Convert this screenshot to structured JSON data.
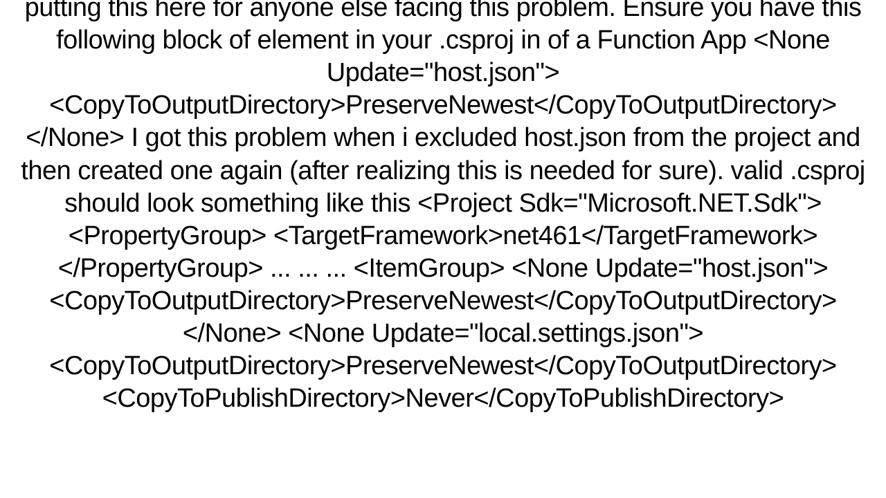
{
  "body": {
    "text": "putting this here for anyone else facing this problem. Ensure you have this following block of element in your .csproj in  of a Function App <None Update=\"host.json\"> <CopyToOutputDirectory>PreserveNewest</CopyToOutputDirectory> </None>  I got this problem when i excluded host.json from the project and then created one again (after realizing this is needed for sure). valid .csproj  should look something like this <Project Sdk=\"Microsoft.NET.Sdk\">   <PropertyGroup>     <TargetFramework>net461</TargetFramework>   </PropertyGroup>   ...   ...   ...    <ItemGroup>     <None Update=\"host.json\">       <CopyToOutputDirectory>PreserveNewest</CopyToOutputDirectory>     </None>     <None Update=\"local.settings.json\">       <CopyToOutputDirectory>PreserveNewest</CopyToOutputDirectory>       <CopyToPublishDirectory>Never</CopyToPublishDirectory>"
  }
}
